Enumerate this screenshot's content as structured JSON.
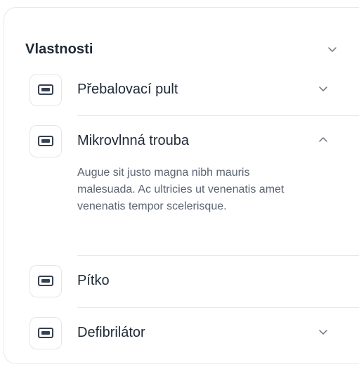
{
  "panel": {
    "title": "Vlastnosti"
  },
  "items": [
    {
      "label": "Přebalovací pult",
      "expanded": false,
      "has_chevron": true
    },
    {
      "label": "Mikrovlnná trouba",
      "expanded": true,
      "has_chevron": true,
      "description": "Augue sit justo magna nibh mauris malesuada. Ac ultricies ut venenatis amet venenatis tempor scelerisque."
    },
    {
      "label": "Pítko",
      "expanded": false,
      "has_chevron": false
    },
    {
      "label": "Defibrilátor",
      "expanded": false,
      "has_chevron": true
    }
  ],
  "icons": {
    "item_icon": "device-icon",
    "collapsed": "chevron-down-icon",
    "expanded": "chevron-up-icon"
  },
  "colors": {
    "text": "#1f2937",
    "muted": "#5b6472",
    "border": "#e6e8ee"
  }
}
